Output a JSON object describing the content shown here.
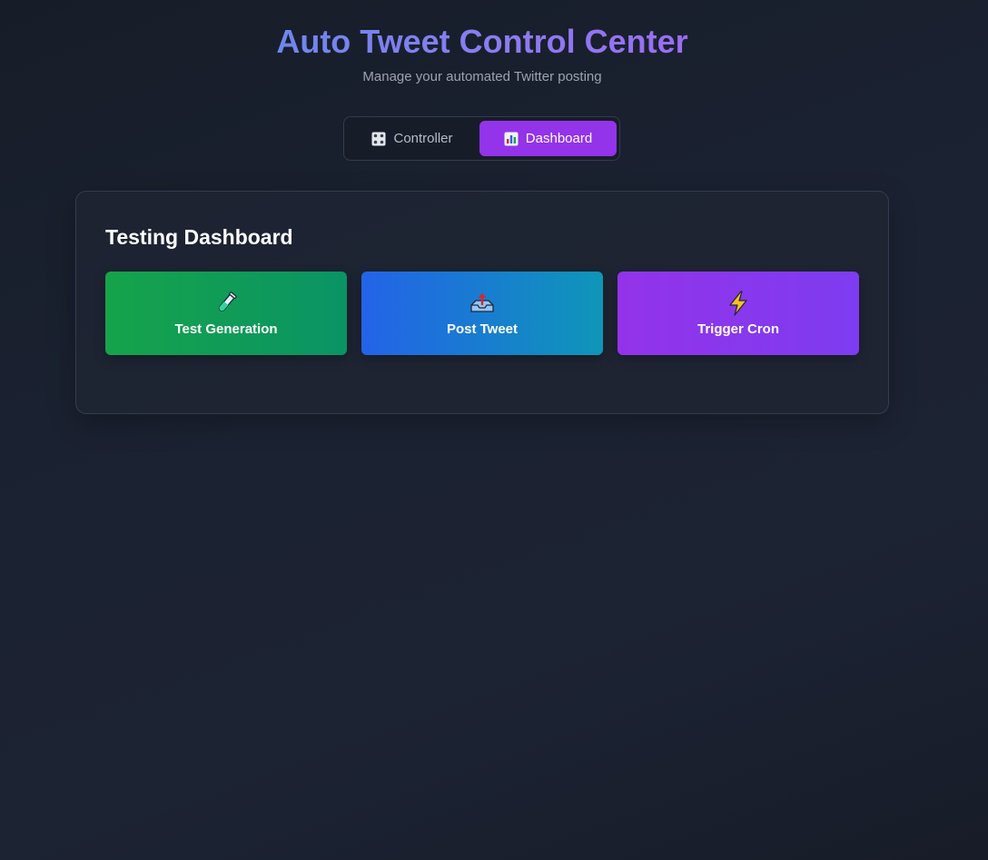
{
  "header": {
    "title": "Auto Tweet Control Center",
    "subtitle": "Manage your automated Twitter posting"
  },
  "tabs": [
    {
      "label": "Controller",
      "icon": "control-knobs-icon",
      "active": false
    },
    {
      "label": "Dashboard",
      "icon": "bar-chart-icon",
      "active": true
    }
  ],
  "panel": {
    "title": "Testing Dashboard",
    "actions": [
      {
        "label": "Test Generation",
        "icon": "test-tube-icon",
        "color_from": "#16a34a",
        "color_to": "#0a9465"
      },
      {
        "label": "Post Tweet",
        "icon": "outbox-tray-icon",
        "color_from": "#2363e8",
        "color_to": "#0e96b8"
      },
      {
        "label": "Trigger Cron",
        "icon": "lightning-icon",
        "color_from": "#9333ea",
        "color_to": "#7e3cf0"
      }
    ]
  },
  "colors": {
    "accent": "#9333ea",
    "title_gradient_from": "#6e86ee",
    "title_gradient_to": "#9a6df2",
    "background": "#1b2232"
  }
}
